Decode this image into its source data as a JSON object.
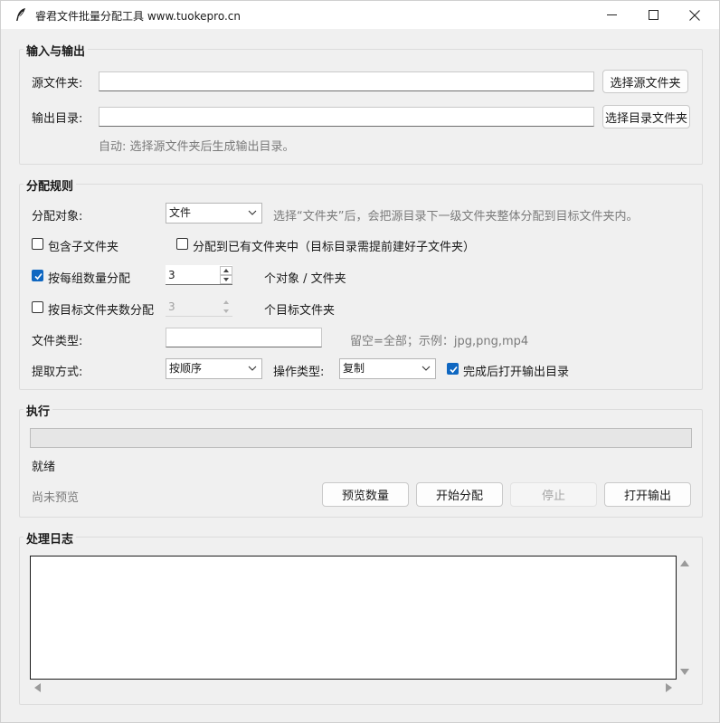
{
  "window": {
    "title": "睿君文件批量分配工具  www.tuokepro.cn"
  },
  "io": {
    "group_title": "输入与输出",
    "source_label": "源文件夹:",
    "source_value": "",
    "choose_source_button": "选择源文件夹",
    "output_label": "输出目录:",
    "output_value": "",
    "choose_output_button": "选择目录文件夹",
    "auto_hint": "自动: 选择源文件夹后生成输出目录。"
  },
  "rules": {
    "group_title": "分配规则",
    "target_label": "分配对象:",
    "target_value": "文件",
    "target_hint": "选择“文件夹”后，会把源目录下一级文件夹整体分配到目标文件夹内。",
    "include_sub_label": "包含子文件夹",
    "include_sub_checked": false,
    "existing_label": "分配到已有文件夹中（目标目录需提前建好子文件夹）",
    "existing_checked": false,
    "per_group_label": "按每组数量分配",
    "per_group_checked": true,
    "per_group_value": "3",
    "per_group_unit": "个对象 / 文件夹",
    "by_target_label": "按目标文件夹数分配",
    "by_target_checked": false,
    "by_target_value": "3",
    "by_target_unit": "个目标文件夹",
    "file_type_label": "文件类型:",
    "file_type_value": "",
    "file_type_hint": "留空=全部；示例：jpg,png,mp4",
    "extract_label": "提取方式:",
    "extract_value": "按顺序",
    "op_label": "操作类型:",
    "op_value": "复制",
    "open_after_label": "完成后打开输出目录",
    "open_after_checked": true
  },
  "exec": {
    "group_title": "执行",
    "progress": 0,
    "status": "就绪",
    "preview_status": "尚未预览",
    "preview_button": "预览数量",
    "start_button": "开始分配",
    "stop_button": "停止",
    "open_output_button": "打开输出"
  },
  "log": {
    "group_title": "处理日志",
    "content": ""
  },
  "colors": {
    "accent": "#0f67c1",
    "window_bg": "#f0f0f0"
  }
}
